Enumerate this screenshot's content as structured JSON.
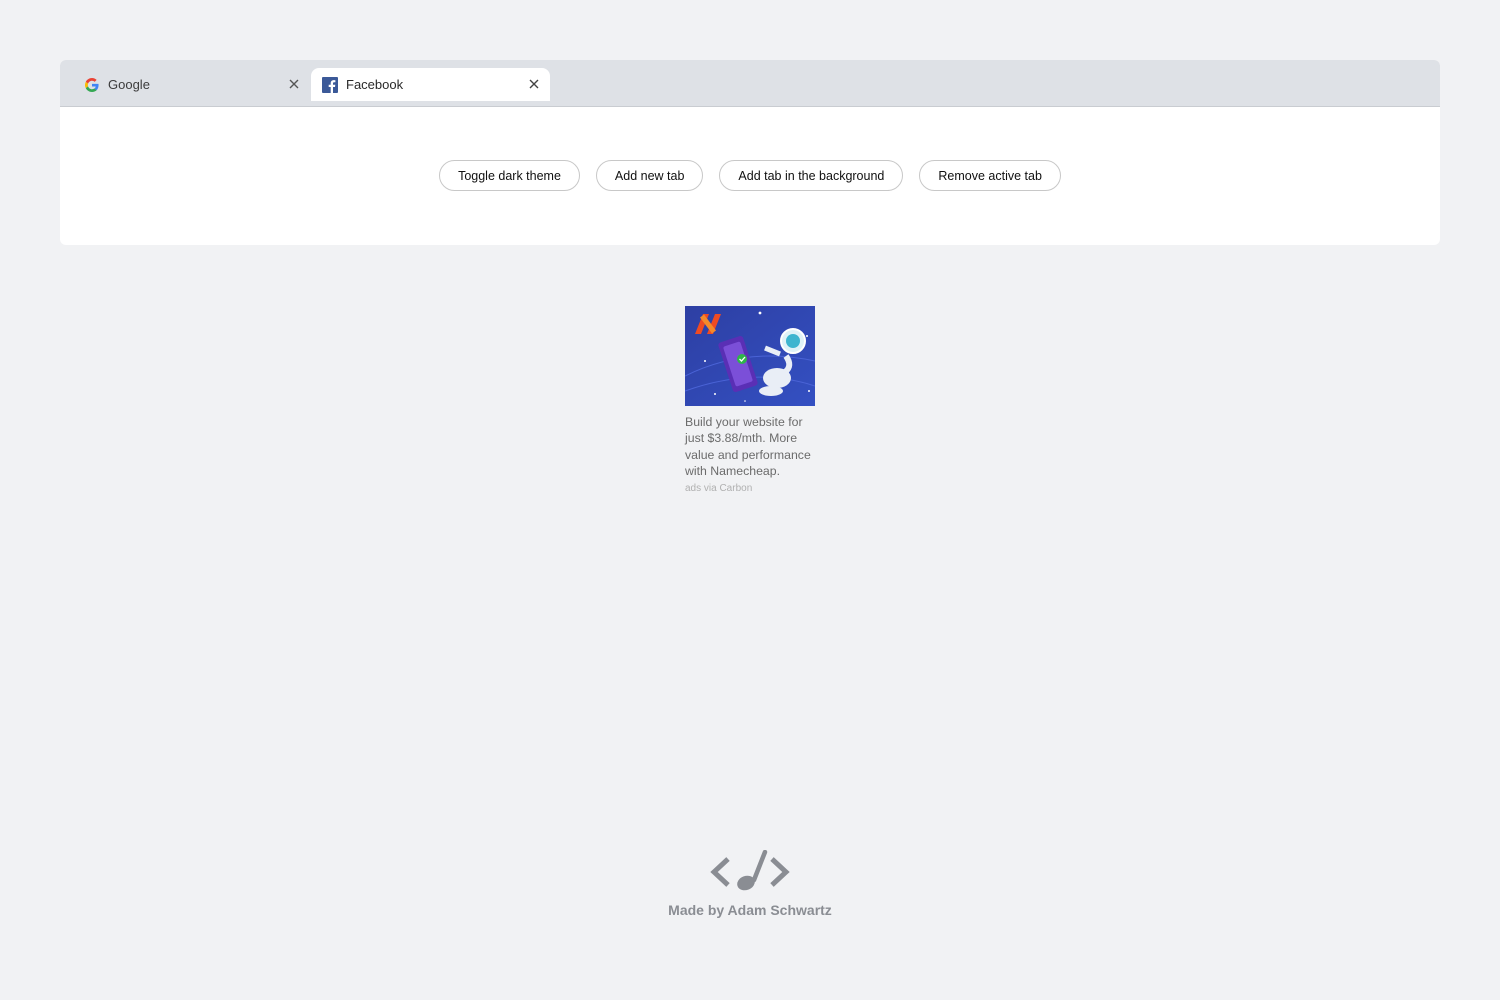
{
  "tabs": [
    {
      "title": "Google",
      "favicon": "google-icon",
      "active": false
    },
    {
      "title": "Facebook",
      "favicon": "facebook-icon",
      "active": true
    }
  ],
  "buttons": {
    "toggle_dark": "Toggle dark theme",
    "add_new": "Add new tab",
    "add_background": "Add tab in the background",
    "remove_active": "Remove active tab"
  },
  "ad": {
    "image": "namecheap-astronaut-illustration",
    "text": "Build your website for just $3.88/mth. More value and performance with Namecheap.",
    "via": "ads via Carbon"
  },
  "footer": {
    "logo": "code-music-note-icon",
    "text": "Made by Adam Schwartz"
  },
  "colors": {
    "page_bg": "#f1f2f4",
    "tabbar_bg": "#dee1e6",
    "active_tab_bg": "#ffffff",
    "facebook_blue": "#3b5998",
    "ad_bg": "#2f4aa8",
    "namecheap_orange": "#f26522"
  }
}
